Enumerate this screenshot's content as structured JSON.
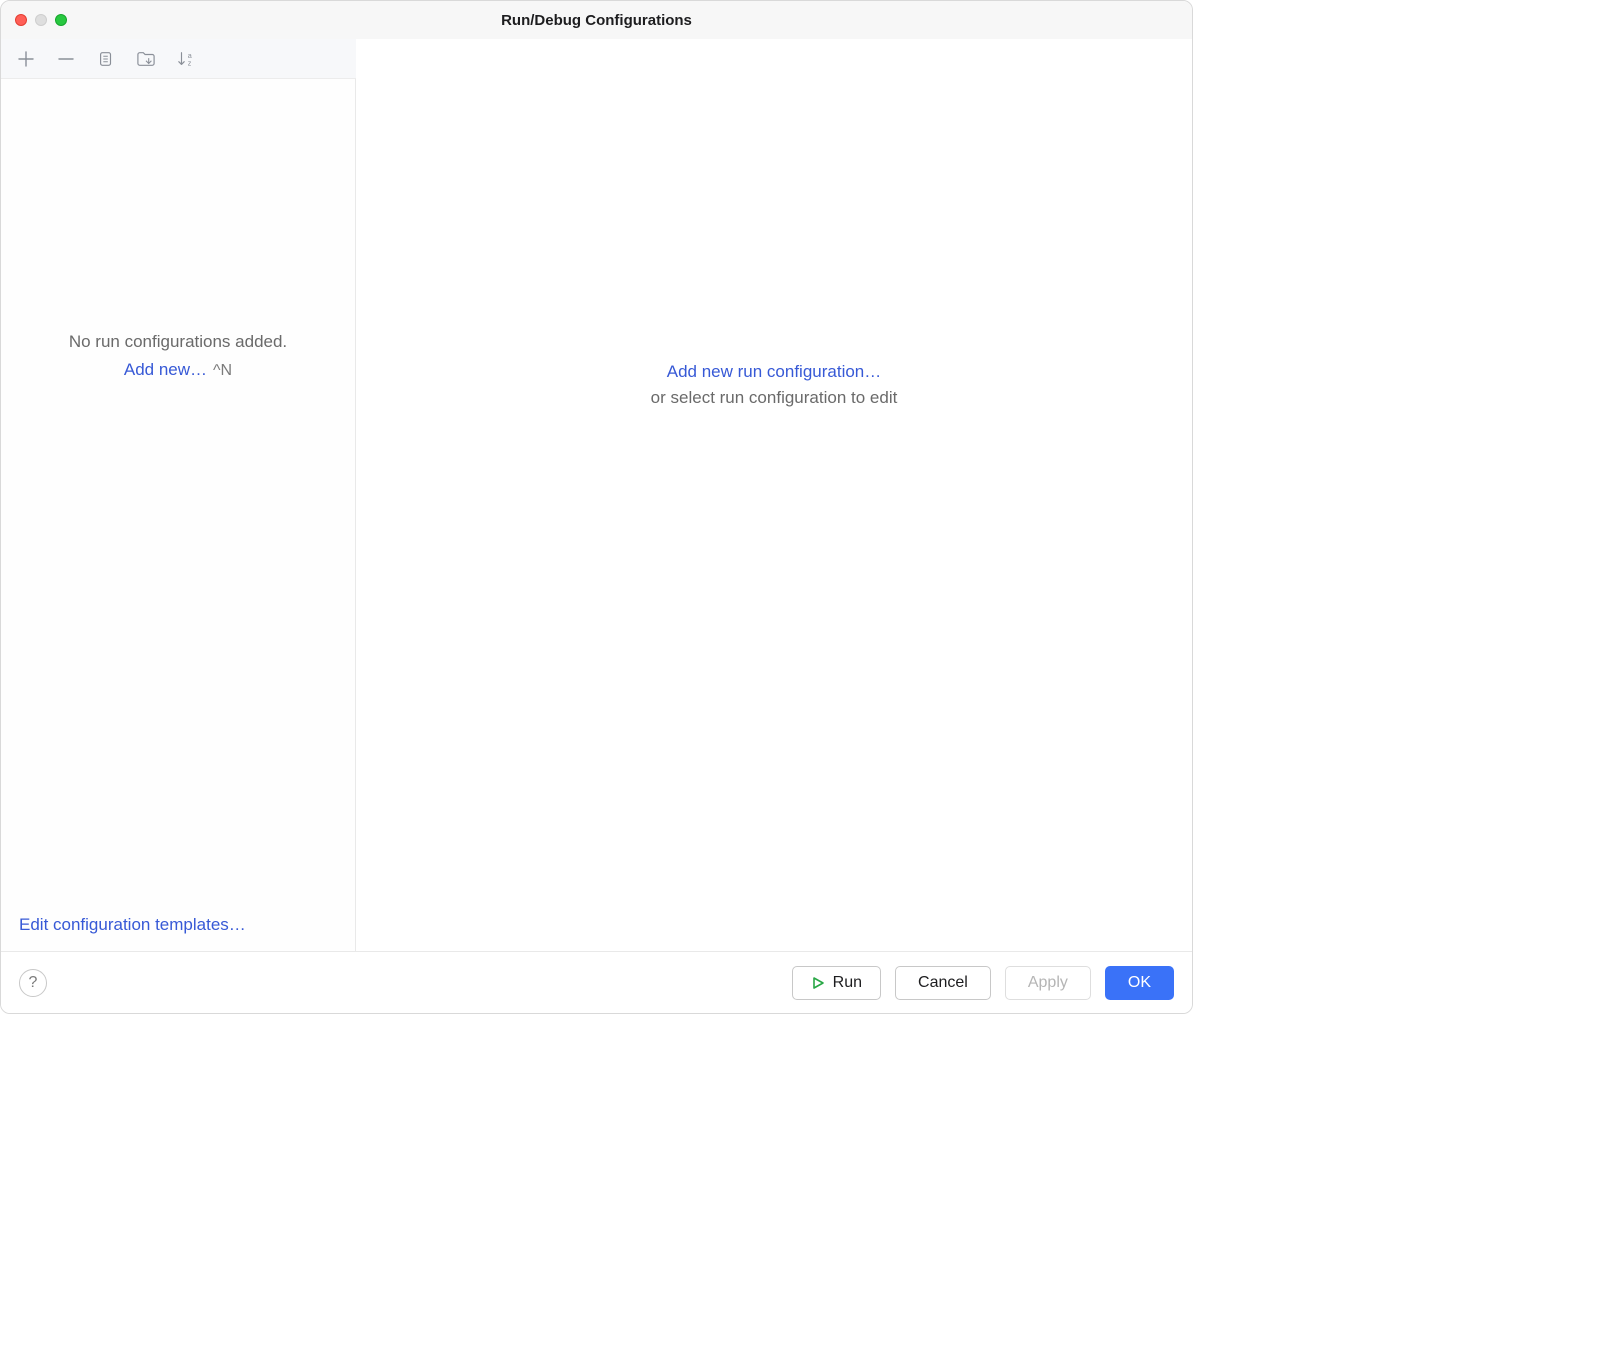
{
  "window": {
    "title": "Run/Debug Configurations"
  },
  "toolbar": {
    "add_icon": "plus-icon",
    "remove_icon": "minus-icon",
    "copy_icon": "copy-icon",
    "save_icon": "folder-arrow-icon",
    "sort_icon": "sort-alpha-icon"
  },
  "sidebar": {
    "empty_message": "No run configurations added.",
    "add_new_label": "Add new…",
    "add_new_shortcut": "^N",
    "edit_templates_label": "Edit configuration templates…"
  },
  "main": {
    "add_new_label": "Add new run configuration…",
    "subtext": "or select run configuration to edit"
  },
  "footer": {
    "help_label": "?",
    "run_label": "Run",
    "cancel_label": "Cancel",
    "apply_label": "Apply",
    "ok_label": "OK"
  }
}
